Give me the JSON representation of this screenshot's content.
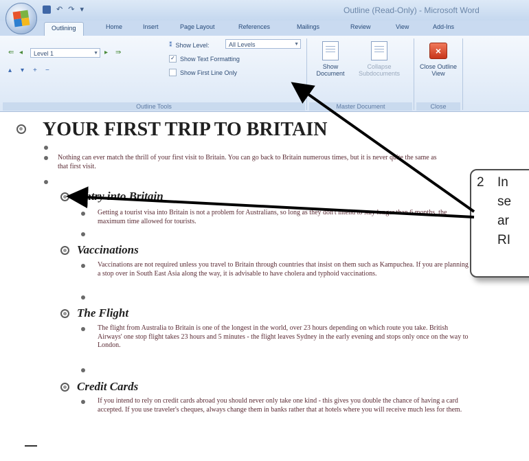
{
  "window": {
    "title": "Outline (Read-Only) - Microsoft Word"
  },
  "tabs": [
    {
      "label": "Outlining",
      "active": true
    },
    {
      "label": "Home"
    },
    {
      "label": "Insert"
    },
    {
      "label": "Page Layout"
    },
    {
      "label": "References"
    },
    {
      "label": "Mailings"
    },
    {
      "label": "Review"
    },
    {
      "label": "View"
    },
    {
      "label": "Add-Ins"
    }
  ],
  "ribbon": {
    "outline_tools": {
      "level_value": "Level 1",
      "show_level_label": "Show Level:",
      "show_level_value": "All Levels",
      "show_text_formatting": {
        "label": "Show Text Formatting",
        "checked": true
      },
      "show_first_line_only": {
        "label": "Show First Line Only",
        "checked": false
      },
      "group_label": "Outline Tools"
    },
    "master_document": {
      "show_document": "Show Document",
      "collapse_subdocuments": "Collapse Subdocuments",
      "group_label": "Master Document"
    },
    "close": {
      "button_label": "Close Outline View",
      "group_label": "Close"
    }
  },
  "document": {
    "heading": "YOUR FIRST TRIP TO BRITAIN",
    "intro": "Nothing can ever match the thrill of your first visit to Britain. You can go back to Britain numerous times, but it is never quite the same as that first visit.",
    "sections": [
      {
        "title": "Entry into Britain",
        "body": "Getting a tourist visa into Britain is not a problem for Australians, so long as they don't intend to stay longer than 6 months, the maximum time allowed for tourists."
      },
      {
        "title": "Vaccinations",
        "body": "Vaccinations are not required unless you travel to Britain through countries that insist on them such as Kampuchea. If you are planning a stop over in South East Asia along the way, it is advisable to have cholera and typhoid vaccinations."
      },
      {
        "title": "The Flight",
        "body": "The flight from Australia to Britain is one of the longest in the world, over 23 hours depending on which route you take. British Airways' one stop flight takes 23 hours and 5 minutes - the flight leaves Sydney in the early evening and stops only once on the way to London."
      },
      {
        "title": "Credit Cards",
        "body": "If you intend to rely on credit cards abroad you should never only take one kind - this gives you double the chance of having a card accepted. If you use traveler's cheques, always change them in banks rather that at hotels where you will receive much less for them."
      }
    ]
  },
  "callout": {
    "number": "2",
    "lines": [
      "In",
      "se",
      "ar",
      "RI"
    ]
  },
  "colors": {
    "ribbon_bg": "#dbe7f6",
    "callout_border": "#4d4d4d",
    "arrow": "#000000",
    "body_text": "#5a2a33"
  }
}
